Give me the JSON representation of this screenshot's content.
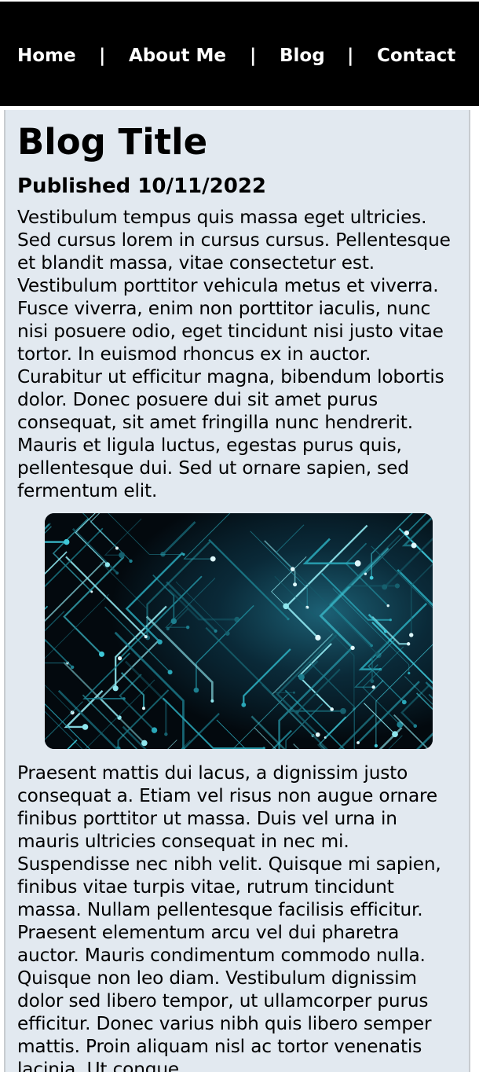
{
  "nav": {
    "items": [
      "Home",
      "About Me",
      "Blog",
      "Contact"
    ],
    "separator": "|"
  },
  "post": {
    "title": "Blog Title",
    "published": "Published 10/11/2022",
    "paragraph1": "Vestibulum tempus quis massa eget ultricies. Sed cursus lorem in cursus cursus. Pellentesque et blandit massa, vitae consectetur est. Vestibulum porttitor vehicula metus et viverra. Fusce viverra, enim non porttitor iaculis, nunc nisi posuere odio, eget tincidunt nisi justo vitae tortor. In euismod rhoncus ex in auctor. Curabitur ut efficitur magna, bibendum lobortis dolor. Donec posuere dui sit amet purus consequat, sit amet fringilla nunc hendrerit. Mauris et ligula luctus, egestas purus quis, pellentesque dui. Sed ut ornare sapien, sed fermentum elit.",
    "image_icon": "circuit-board-image",
    "paragraph2": "Praesent mattis dui lacus, a dignissim justo consequat a. Etiam vel risus non augue ornare finibus porttitor ut massa. Duis vel urna in mauris ultricies consequat in nec mi. Suspendisse nec nibh velit. Quisque mi sapien, finibus vitae turpis vitae, rutrum tincidunt massa. Nullam pellentesque facilisis efficitur. Praesent elementum arcu vel dui pharetra auctor. Mauris condimentum commodo nulla. Quisque non leo diam. Vestibulum dignissim dolor sed libero tempor, ut ullamcorper purus efficitur. Donec varius nibh quis libero semper mattis. Proin aliquam nisl ac tortor venenatis lacinia. Ut congue"
  },
  "colors": {
    "nav_bg": "#000000",
    "nav_text": "#ffffff",
    "content_bg": "#e2e9f0",
    "circuit_accent": "#3fc8d8"
  }
}
